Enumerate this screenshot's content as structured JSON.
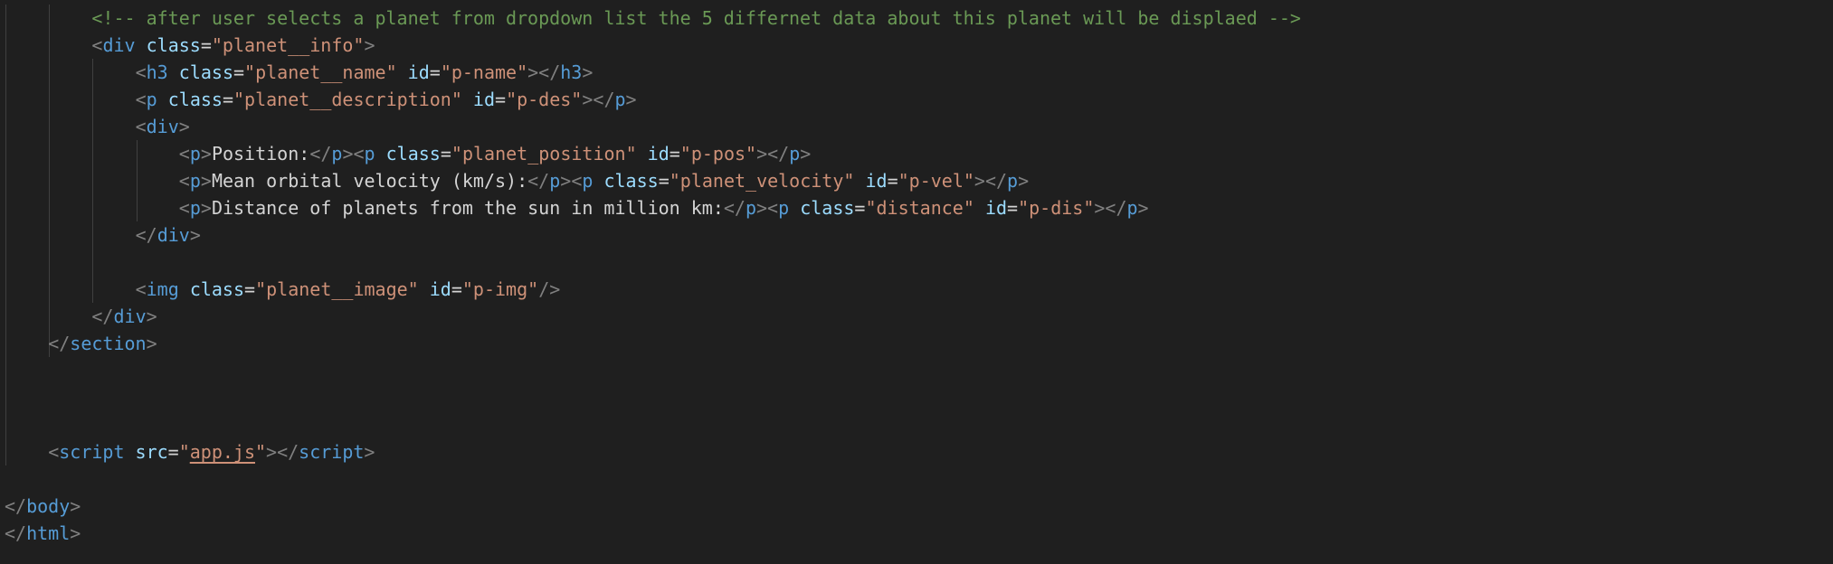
{
  "editor": {
    "theme": "dark",
    "colors": {
      "background": "#1f1f1f",
      "tag": "#569cd6",
      "bracket": "#808080",
      "attribute": "#9cdcfe",
      "string": "#ce9178",
      "text": "#d4d4d4",
      "comment": "#6a9955"
    },
    "lines": [
      {
        "indent": 8,
        "tokens": [
          {
            "k": "comment",
            "t": "<!-- after user selects a planet from dropdown list the 5 differnet data about this planet will be displaed -->"
          }
        ]
      },
      {
        "indent": 8,
        "tokens": [
          {
            "k": "punct",
            "t": "<"
          },
          {
            "k": "tag",
            "t": "div"
          },
          {
            "k": "text",
            "t": " "
          },
          {
            "k": "attr",
            "t": "class"
          },
          {
            "k": "text",
            "t": "="
          },
          {
            "k": "str",
            "t": "\"planet__info\""
          },
          {
            "k": "punct",
            "t": ">"
          }
        ]
      },
      {
        "indent": 12,
        "tokens": [
          {
            "k": "punct",
            "t": "<"
          },
          {
            "k": "tag",
            "t": "h3"
          },
          {
            "k": "text",
            "t": " "
          },
          {
            "k": "attr",
            "t": "class"
          },
          {
            "k": "text",
            "t": "="
          },
          {
            "k": "str",
            "t": "\"planet__name\""
          },
          {
            "k": "text",
            "t": " "
          },
          {
            "k": "attr",
            "t": "id"
          },
          {
            "k": "text",
            "t": "="
          },
          {
            "k": "str",
            "t": "\"p-name\""
          },
          {
            "k": "punct",
            "t": "></"
          },
          {
            "k": "tag",
            "t": "h3"
          },
          {
            "k": "punct",
            "t": ">"
          }
        ]
      },
      {
        "indent": 12,
        "tokens": [
          {
            "k": "punct",
            "t": "<"
          },
          {
            "k": "tag",
            "t": "p"
          },
          {
            "k": "text",
            "t": " "
          },
          {
            "k": "attr",
            "t": "class"
          },
          {
            "k": "text",
            "t": "="
          },
          {
            "k": "str",
            "t": "\"planet__description\""
          },
          {
            "k": "text",
            "t": " "
          },
          {
            "k": "attr",
            "t": "id"
          },
          {
            "k": "text",
            "t": "="
          },
          {
            "k": "str",
            "t": "\"p-des\""
          },
          {
            "k": "punct",
            "t": "></"
          },
          {
            "k": "tag",
            "t": "p"
          },
          {
            "k": "punct",
            "t": ">"
          }
        ]
      },
      {
        "indent": 12,
        "tokens": [
          {
            "k": "punct",
            "t": "<"
          },
          {
            "k": "tag",
            "t": "div"
          },
          {
            "k": "punct",
            "t": ">"
          }
        ]
      },
      {
        "indent": 16,
        "tokens": [
          {
            "k": "punct",
            "t": "<"
          },
          {
            "k": "tag",
            "t": "p"
          },
          {
            "k": "punct",
            "t": ">"
          },
          {
            "k": "text",
            "t": "Position:"
          },
          {
            "k": "punct",
            "t": "</"
          },
          {
            "k": "tag",
            "t": "p"
          },
          {
            "k": "punct",
            "t": "><"
          },
          {
            "k": "tag",
            "t": "p"
          },
          {
            "k": "text",
            "t": " "
          },
          {
            "k": "attr",
            "t": "class"
          },
          {
            "k": "text",
            "t": "="
          },
          {
            "k": "str",
            "t": "\"planet_position\""
          },
          {
            "k": "text",
            "t": " "
          },
          {
            "k": "attr",
            "t": "id"
          },
          {
            "k": "text",
            "t": "="
          },
          {
            "k": "str",
            "t": "\"p-pos\""
          },
          {
            "k": "punct",
            "t": "></"
          },
          {
            "k": "tag",
            "t": "p"
          },
          {
            "k": "punct",
            "t": ">"
          }
        ]
      },
      {
        "indent": 16,
        "tokens": [
          {
            "k": "punct",
            "t": "<"
          },
          {
            "k": "tag",
            "t": "p"
          },
          {
            "k": "punct",
            "t": ">"
          },
          {
            "k": "text",
            "t": "Mean orbital velocity (km/s):"
          },
          {
            "k": "punct",
            "t": "</"
          },
          {
            "k": "tag",
            "t": "p"
          },
          {
            "k": "punct",
            "t": "><"
          },
          {
            "k": "tag",
            "t": "p"
          },
          {
            "k": "text",
            "t": " "
          },
          {
            "k": "attr",
            "t": "class"
          },
          {
            "k": "text",
            "t": "="
          },
          {
            "k": "str",
            "t": "\"planet_velocity\""
          },
          {
            "k": "text",
            "t": " "
          },
          {
            "k": "attr",
            "t": "id"
          },
          {
            "k": "text",
            "t": "="
          },
          {
            "k": "str",
            "t": "\"p-vel\""
          },
          {
            "k": "punct",
            "t": "></"
          },
          {
            "k": "tag",
            "t": "p"
          },
          {
            "k": "punct",
            "t": ">"
          }
        ]
      },
      {
        "indent": 16,
        "tokens": [
          {
            "k": "punct",
            "t": "<"
          },
          {
            "k": "tag",
            "t": "p"
          },
          {
            "k": "punct",
            "t": ">"
          },
          {
            "k": "text",
            "t": "Distance of planets from the sun in million km:"
          },
          {
            "k": "punct",
            "t": "</"
          },
          {
            "k": "tag",
            "t": "p"
          },
          {
            "k": "punct",
            "t": "><"
          },
          {
            "k": "tag",
            "t": "p"
          },
          {
            "k": "text",
            "t": " "
          },
          {
            "k": "attr",
            "t": "class"
          },
          {
            "k": "text",
            "t": "="
          },
          {
            "k": "str",
            "t": "\"distance\""
          },
          {
            "k": "text",
            "t": " "
          },
          {
            "k": "attr",
            "t": "id"
          },
          {
            "k": "text",
            "t": "="
          },
          {
            "k": "str",
            "t": "\"p-dis\""
          },
          {
            "k": "punct",
            "t": "></"
          },
          {
            "k": "tag",
            "t": "p"
          },
          {
            "k": "punct",
            "t": ">"
          }
        ]
      },
      {
        "indent": 12,
        "tokens": [
          {
            "k": "punct",
            "t": "</"
          },
          {
            "k": "tag",
            "t": "div"
          },
          {
            "k": "punct",
            "t": ">"
          }
        ]
      },
      {
        "indent": 0,
        "tokens": []
      },
      {
        "indent": 12,
        "tokens": [
          {
            "k": "punct",
            "t": "<"
          },
          {
            "k": "tag",
            "t": "img"
          },
          {
            "k": "text",
            "t": " "
          },
          {
            "k": "attr",
            "t": "class"
          },
          {
            "k": "text",
            "t": "="
          },
          {
            "k": "str",
            "t": "\"planet__image\""
          },
          {
            "k": "text",
            "t": " "
          },
          {
            "k": "attr",
            "t": "id"
          },
          {
            "k": "text",
            "t": "="
          },
          {
            "k": "str",
            "t": "\"p-img\""
          },
          {
            "k": "punct",
            "t": "/>"
          }
        ]
      },
      {
        "indent": 8,
        "tokens": [
          {
            "k": "punct",
            "t": "</"
          },
          {
            "k": "tag",
            "t": "div"
          },
          {
            "k": "punct",
            "t": ">"
          }
        ]
      },
      {
        "indent": 4,
        "tokens": [
          {
            "k": "punct",
            "t": "</"
          },
          {
            "k": "tag",
            "t": "section"
          },
          {
            "k": "punct",
            "t": ">"
          }
        ]
      },
      {
        "indent": 0,
        "tokens": []
      },
      {
        "indent": 0,
        "tokens": []
      },
      {
        "indent": 0,
        "tokens": []
      },
      {
        "indent": 4,
        "tokens": [
          {
            "k": "punct",
            "t": "<"
          },
          {
            "k": "tag",
            "t": "script"
          },
          {
            "k": "text",
            "t": " "
          },
          {
            "k": "attr",
            "t": "src"
          },
          {
            "k": "text",
            "t": "="
          },
          {
            "k": "str",
            "t": "\""
          },
          {
            "k": "str",
            "t": "app.js",
            "link": true
          },
          {
            "k": "str",
            "t": "\""
          },
          {
            "k": "punct",
            "t": "></"
          },
          {
            "k": "tag",
            "t": "script"
          },
          {
            "k": "punct",
            "t": ">"
          }
        ]
      },
      {
        "indent": 0,
        "tokens": []
      },
      {
        "indent": 0,
        "tokens": [
          {
            "k": "punct",
            "t": "</"
          },
          {
            "k": "tag",
            "t": "body"
          },
          {
            "k": "punct",
            "t": ">"
          }
        ]
      },
      {
        "indent": 0,
        "tokens": [
          {
            "k": "punct",
            "t": "</"
          },
          {
            "k": "tag",
            "t": "html"
          },
          {
            "k": "punct",
            "t": ">"
          }
        ]
      }
    ]
  }
}
